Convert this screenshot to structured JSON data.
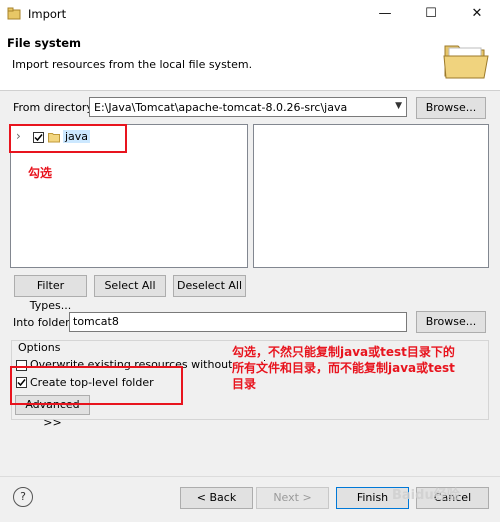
{
  "window": {
    "title": "Import",
    "minimize_glyph": "—",
    "maximize_glyph": "☐",
    "close_glyph": "✕"
  },
  "banner": {
    "heading": "File system",
    "description": "Import resources from the local file system.",
    "graphic": "open-folder-icon"
  },
  "from_directory": {
    "label": "From directory:",
    "value": "E:\\Java\\Tomcat\\apache-tomcat-8.0.26-src\\java",
    "browse_label": "Browse..."
  },
  "tree": {
    "items": [
      {
        "label": "java",
        "checked": true,
        "expand_glyph": "›",
        "icon": "folder-icon"
      }
    ]
  },
  "selection_buttons": {
    "filter_types": "Filter Types...",
    "select_all": "Select All",
    "deselect_all": "Deselect All"
  },
  "into_folder": {
    "label": "Into folder:",
    "value": "tomcat8",
    "browse_label": "Browse..."
  },
  "options": {
    "group_label": "Options",
    "overwrite_label": "Overwrite existing resources without warning",
    "overwrite_checked": false,
    "create_top_level_label": "Create top-level folder",
    "create_top_level_checked": true,
    "advanced_label": "Advanced >>"
  },
  "annotations": {
    "note1": "勾选",
    "note2_line1": "勾选，不然只能复制java或test目录下的",
    "note2_line2": "所有文件和目录，而不能复制java或test",
    "note2_line3": "目录",
    "color": "#e8141e"
  },
  "footer": {
    "help_glyph": "?",
    "back_label": "< Back",
    "next_label": "Next >",
    "finish_label": "Finish",
    "cancel_label": "Cancel"
  },
  "watermark": "Baidu经验"
}
